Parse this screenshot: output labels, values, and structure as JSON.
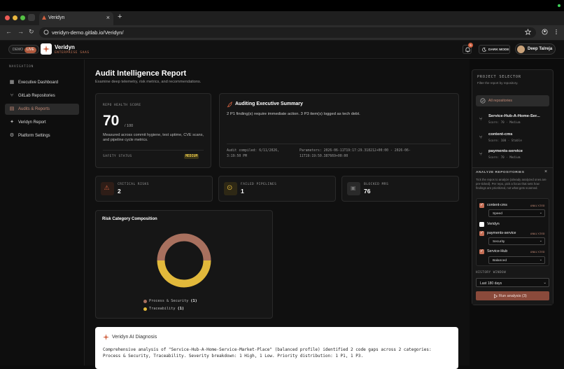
{
  "browser": {
    "tab_title": "Veridyn",
    "tab_close": "×",
    "new_tab": "+",
    "url": "veridyn-demo.gitlab.io/Veridyn/",
    "nav": {
      "back": "←",
      "forward": "→",
      "reload": "↻"
    }
  },
  "header": {
    "demo_label": "DEMO",
    "live_label": "LIVE",
    "brand_name": "Veridyn",
    "brand_tagline": "ENTERPRISE SAAS",
    "notification_count": "5",
    "dark_mode_label": "DARK MODE",
    "user_name": "Deep Talreja"
  },
  "sidebar": {
    "heading": "NAVIGATION",
    "items": [
      {
        "label": "Executive Dashboard",
        "icon": "dashboard-icon",
        "glyph": "▦"
      },
      {
        "label": "GitLab Repositories",
        "icon": "branch-icon",
        "glyph": "⑂"
      },
      {
        "label": "Audits & Reports",
        "icon": "document-icon",
        "glyph": "▤"
      },
      {
        "label": "Veridyn Report",
        "icon": "sparkle-icon",
        "glyph": "✦"
      },
      {
        "label": "Platform Settings",
        "icon": "gear-icon",
        "glyph": "⚙"
      }
    ]
  },
  "main": {
    "title": "Audit Intelligence Report",
    "subtitle": "Examine deep telemetry, risk metrics, and recommendations.",
    "health": {
      "label": "REPO HEALTH SCORE",
      "score": "70",
      "denominator": "/ 100",
      "description": "Measured across commit hygiene, test uptime, CVE scans, and pipeline cycle metrics.",
      "safety_label": "SAFETY STATUS",
      "safety_value": "MEDIUM"
    },
    "summary": {
      "title": "Auditing Executive Summary",
      "text": "2 P1 finding(s) require immediate action. 3 P3 item(s) logged as tech debt.",
      "compiled_label": "Audit compiled: 6/11/2026,",
      "compiled_time": "3:19:50 PM",
      "params_line1": "Parameters: 2026-06-11T19:17:29.318212+00:00 - 2026-06-",
      "params_line2": "11T19:19:50.387669+00:00"
    },
    "stats": [
      {
        "label": "CRITICAL RISKS",
        "value": "2",
        "icon": "warning-icon",
        "glyph": "⚠"
      },
      {
        "label": "FAILED PIPELINES",
        "value": "1",
        "icon": "target-icon",
        "glyph": "⊙"
      },
      {
        "label": "BLOCKED MRS",
        "value": "76",
        "icon": "lock-icon",
        "glyph": "▣"
      }
    ],
    "chart_title": "Risk Category Composition",
    "diagnosis": {
      "title": "Veridyn AI Diagnosis",
      "text": "Comprehensive analysis of \"Service-Hub-A-Home-Service-Market-Place\" (balanced profile) identified 2 code gaps across 2 categories: Process & Security, Traceability. Severity breakdown: 1 High, 1 Low. Priority distribution: 1 P1, 1 P3."
    }
  },
  "chart_data": {
    "type": "pie",
    "categories": [
      "Process & Security",
      "Traceability"
    ],
    "values": [
      1,
      1
    ],
    "colors": [
      "#a8705e",
      "#e2b93b"
    ],
    "title": "Risk Category Composition",
    "legend": "bottom"
  },
  "project_selector": {
    "title": "PROJECT SELECTOR",
    "subtitle": "Filter the report by repository.",
    "all_label": "All repositories",
    "repos": [
      {
        "name": "Service-Hub-A-Home-Ser...",
        "score": "Score: 70 · Medium"
      },
      {
        "name": "content-cms",
        "score": "Score: 100 · Stable"
      },
      {
        "name": "payments-service",
        "score": "Score: 70 · Medium"
      }
    ]
  },
  "analyze": {
    "title": "ANALYZE REPOSITORIES",
    "close": "×",
    "description": "Tick the repos to analyze (already analyzed ones are pre-ticked). Per repo, pick a focus that sets how findings are prioritized, not what gets scanned.",
    "repos": [
      {
        "name": "content-cms",
        "checked": true,
        "tag": "ANALYZED",
        "focus": "Speed"
      },
      {
        "name": "Veridyn",
        "checked": false,
        "tag": "",
        "focus": ""
      },
      {
        "name": "payments-service",
        "checked": true,
        "tag": "ANALYZED",
        "focus": "Security"
      },
      {
        "name": "Service-Hub",
        "checked": true,
        "tag": "ANALYZED",
        "focus": "Balanced"
      }
    ],
    "history_label": "HISTORY WINDOW",
    "history_value": "Last 180 days",
    "run_label": "Run analysis (3)"
  }
}
